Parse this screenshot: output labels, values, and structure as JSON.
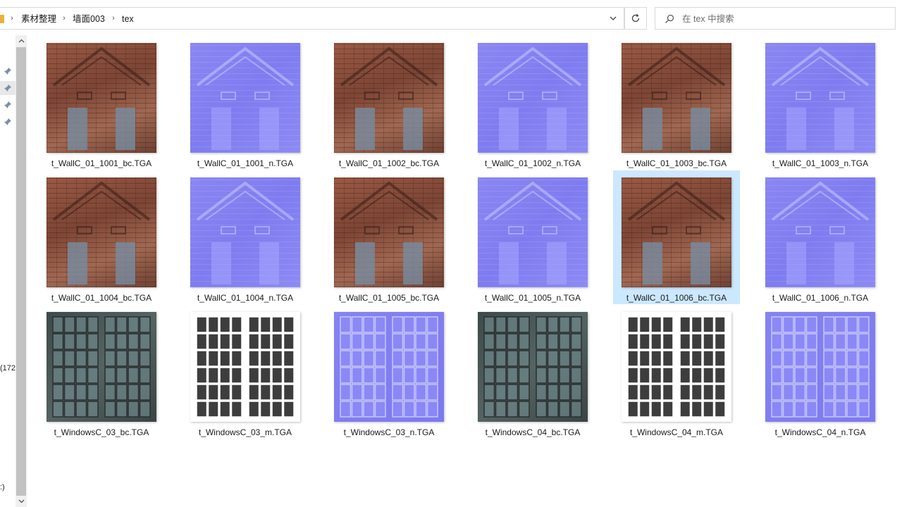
{
  "address_bar": {
    "breadcrumbs": [
      "素材整理",
      "墙面003",
      "tex"
    ]
  },
  "search": {
    "placeholder": "在 tex 中搜索"
  },
  "nav": {
    "fragment_1": "(172",
    "fragment_2": ":)"
  },
  "files": [
    {
      "name": "t_WallC_01_1001_bc.TGA",
      "kind": "brick"
    },
    {
      "name": "t_WallC_01_1001_n.TGA",
      "kind": "normal"
    },
    {
      "name": "t_WallC_01_1002_bc.TGA",
      "kind": "brick"
    },
    {
      "name": "t_WallC_01_1002_n.TGA",
      "kind": "normal"
    },
    {
      "name": "t_WallC_01_1003_bc.TGA",
      "kind": "brick"
    },
    {
      "name": "t_WallC_01_1003_n.TGA",
      "kind": "normal"
    },
    {
      "name": "t_WallC_01_1004_bc.TGA",
      "kind": "brick"
    },
    {
      "name": "t_WallC_01_1004_n.TGA",
      "kind": "normal"
    },
    {
      "name": "t_WallC_01_1005_bc.TGA",
      "kind": "brick"
    },
    {
      "name": "t_WallC_01_1005_n.TGA",
      "kind": "normal"
    },
    {
      "name": "t_WallC_01_1006_bc.TGA",
      "kind": "brick",
      "selected": true
    },
    {
      "name": "t_WallC_01_1006_n.TGA",
      "kind": "normal"
    },
    {
      "name": "t_WindowsC_03_bc.TGA",
      "kind": "window-bc"
    },
    {
      "name": "t_WindowsC_03_m.TGA",
      "kind": "mask"
    },
    {
      "name": "t_WindowsC_03_n.TGA",
      "kind": "normal-win"
    },
    {
      "name": "t_WindowsC_04_bc.TGA",
      "kind": "window-bc"
    },
    {
      "name": "t_WindowsC_04_m.TGA",
      "kind": "mask"
    },
    {
      "name": "t_WindowsC_04_n.TGA",
      "kind": "normal-win"
    }
  ],
  "colors": {
    "selection": "#cce8ff",
    "normal_map": "#807df0",
    "folder": "#e8b33a"
  }
}
